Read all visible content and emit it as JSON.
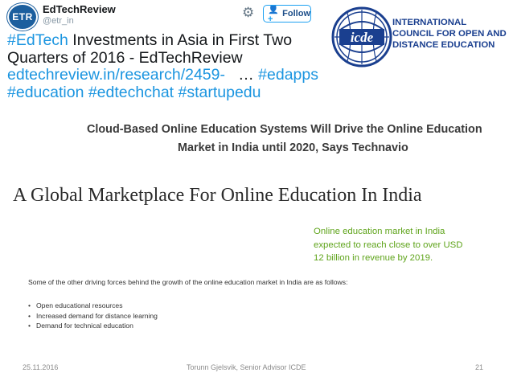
{
  "tweet": {
    "avatar_text": "ETR",
    "name": "EdTechReview",
    "handle": "@etr_in",
    "follow_label": "Follow",
    "icons": {
      "settings": "gear-icon",
      "follow": "person-add-icon"
    },
    "lines": [
      {
        "hashtag": "#EdTech",
        "rest": " Investments in Asia in First Two"
      },
      {
        "text": "Quarters of 2016 - EdTechReview"
      },
      {
        "link": "edtechreview.in/research/2459-",
        "sep": "   … ",
        "hashtag": "#edapps"
      },
      {
        "tags": "#education #edtechchat #startupedu"
      }
    ],
    "colors": {
      "text": "#14171a",
      "link": "#1b95e0"
    }
  },
  "icde": {
    "seal_text": "icde",
    "name_lines": [
      "INTERNATIONAL",
      "COUNCIL FOR OPEN AND",
      "DISTANCE EDUCATION"
    ],
    "color": "#1a3f8f"
  },
  "technavio": {
    "lines": [
      "Cloud-Based Online Education Systems Will Drive the Online Education",
      "Market in India until 2020, Says Technavio"
    ]
  },
  "marketplace": {
    "title": "A Global Marketplace For Online Education In India",
    "highlight_lines": [
      "Online education market in India",
      "expected to reach close to over USD",
      "12 billion in revenue by 2019."
    ],
    "highlight_color": "#5fa41b",
    "intro": "Some of the other driving forces behind the growth of the online education market in India are as follows:",
    "bullets": [
      "Open educational resources",
      "Increased demand for distance learning",
      "Demand for technical education"
    ]
  },
  "footer": {
    "date": "25.11.2016",
    "author": "Torunn Gjelsvik, Senior Advisor ICDE",
    "page": "21"
  }
}
